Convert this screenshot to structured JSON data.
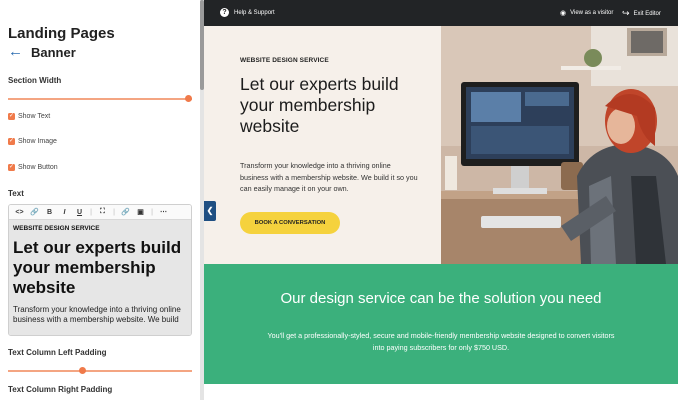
{
  "panel": {
    "title": "Landing Pages",
    "back_label": "Banner",
    "section_width_label": "Section Width",
    "section_width_value": 1.0,
    "checkboxes": [
      {
        "label": "Show Text",
        "checked": true
      },
      {
        "label": "Show Image",
        "checked": true
      },
      {
        "label": "Show Button",
        "checked": true
      }
    ],
    "text_label": "Text",
    "editor": {
      "toolbar_icons": [
        "code-icon",
        "link-icon",
        "bold-icon",
        "italic-icon",
        "underline-icon",
        "fullscreen-icon",
        "link-icon",
        "image-icon",
        "more-icon"
      ],
      "eyebrow": "WEBSITE DESIGN SERVICE",
      "headline": "Let our experts build your membership website",
      "body": "Transform your knowledge into a thriving online business with a membership website. We build"
    },
    "left_padding_label": "Text Column Left Padding",
    "left_padding_value": 0.4,
    "right_padding_label": "Text Column Right Padding"
  },
  "topbar": {
    "help": "Help & Support",
    "view_visitor": "View as a visitor",
    "exit": "Exit Editor"
  },
  "hero": {
    "eyebrow": "WEBSITE DESIGN SERVICE",
    "headline": "Let our experts build your membership website",
    "body": "Transform your knowledge into a thriving online business with a membership website. We build it so you can easily manage it on your own.",
    "cta": "BOOK A CONVERSATION"
  },
  "green": {
    "title": "Our design service can be the solution you need",
    "text": "You'll get a professionally-styled, secure and mobile-friendly membership website designed to convert visitors into paying subscribers for only $750 USD."
  },
  "colors": {
    "accent_orange": "#f07a4a",
    "cta_yellow": "#f5d23d",
    "green": "#3bb07c",
    "topbar": "#222426",
    "collapse_blue": "#1f4f82"
  }
}
